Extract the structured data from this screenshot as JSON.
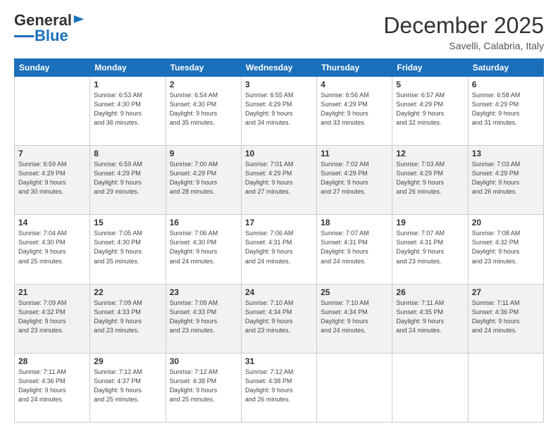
{
  "logo": {
    "general": "General",
    "blue": "Blue"
  },
  "header": {
    "month": "December 2025",
    "location": "Savelli, Calabria, Italy"
  },
  "days_of_week": [
    "Sunday",
    "Monday",
    "Tuesday",
    "Wednesday",
    "Thursday",
    "Friday",
    "Saturday"
  ],
  "weeks": [
    [
      {
        "day": "",
        "info": ""
      },
      {
        "day": "1",
        "info": "Sunrise: 6:53 AM\nSunset: 4:30 PM\nDaylight: 9 hours\nand 36 minutes."
      },
      {
        "day": "2",
        "info": "Sunrise: 6:54 AM\nSunset: 4:30 PM\nDaylight: 9 hours\nand 35 minutes."
      },
      {
        "day": "3",
        "info": "Sunrise: 6:55 AM\nSunset: 4:29 PM\nDaylight: 9 hours\nand 34 minutes."
      },
      {
        "day": "4",
        "info": "Sunrise: 6:56 AM\nSunset: 4:29 PM\nDaylight: 9 hours\nand 33 minutes."
      },
      {
        "day": "5",
        "info": "Sunrise: 6:57 AM\nSunset: 4:29 PM\nDaylight: 9 hours\nand 32 minutes."
      },
      {
        "day": "6",
        "info": "Sunrise: 6:58 AM\nSunset: 4:29 PM\nDaylight: 9 hours\nand 31 minutes."
      }
    ],
    [
      {
        "day": "7",
        "info": "Sunrise: 6:59 AM\nSunset: 4:29 PM\nDaylight: 9 hours\nand 30 minutes."
      },
      {
        "day": "8",
        "info": "Sunrise: 6:59 AM\nSunset: 4:29 PM\nDaylight: 9 hours\nand 29 minutes."
      },
      {
        "day": "9",
        "info": "Sunrise: 7:00 AM\nSunset: 4:29 PM\nDaylight: 9 hours\nand 28 minutes."
      },
      {
        "day": "10",
        "info": "Sunrise: 7:01 AM\nSunset: 4:29 PM\nDaylight: 9 hours\nand 27 minutes."
      },
      {
        "day": "11",
        "info": "Sunrise: 7:02 AM\nSunset: 4:29 PM\nDaylight: 9 hours\nand 27 minutes."
      },
      {
        "day": "12",
        "info": "Sunrise: 7:03 AM\nSunset: 4:29 PM\nDaylight: 9 hours\nand 26 minutes."
      },
      {
        "day": "13",
        "info": "Sunrise: 7:03 AM\nSunset: 4:29 PM\nDaylight: 9 hours\nand 26 minutes."
      }
    ],
    [
      {
        "day": "14",
        "info": "Sunrise: 7:04 AM\nSunset: 4:30 PM\nDaylight: 9 hours\nand 25 minutes."
      },
      {
        "day": "15",
        "info": "Sunrise: 7:05 AM\nSunset: 4:30 PM\nDaylight: 9 hours\nand 25 minutes."
      },
      {
        "day": "16",
        "info": "Sunrise: 7:06 AM\nSunset: 4:30 PM\nDaylight: 9 hours\nand 24 minutes."
      },
      {
        "day": "17",
        "info": "Sunrise: 7:06 AM\nSunset: 4:31 PM\nDaylight: 9 hours\nand 24 minutes."
      },
      {
        "day": "18",
        "info": "Sunrise: 7:07 AM\nSunset: 4:31 PM\nDaylight: 9 hours\nand 24 minutes."
      },
      {
        "day": "19",
        "info": "Sunrise: 7:07 AM\nSunset: 4:31 PM\nDaylight: 9 hours\nand 23 minutes."
      },
      {
        "day": "20",
        "info": "Sunrise: 7:08 AM\nSunset: 4:32 PM\nDaylight: 9 hours\nand 23 minutes."
      }
    ],
    [
      {
        "day": "21",
        "info": "Sunrise: 7:09 AM\nSunset: 4:32 PM\nDaylight: 9 hours\nand 23 minutes."
      },
      {
        "day": "22",
        "info": "Sunrise: 7:09 AM\nSunset: 4:33 PM\nDaylight: 9 hours\nand 23 minutes."
      },
      {
        "day": "23",
        "info": "Sunrise: 7:09 AM\nSunset: 4:33 PM\nDaylight: 9 hours\nand 23 minutes."
      },
      {
        "day": "24",
        "info": "Sunrise: 7:10 AM\nSunset: 4:34 PM\nDaylight: 9 hours\nand 23 minutes."
      },
      {
        "day": "25",
        "info": "Sunrise: 7:10 AM\nSunset: 4:34 PM\nDaylight: 9 hours\nand 24 minutes."
      },
      {
        "day": "26",
        "info": "Sunrise: 7:11 AM\nSunset: 4:35 PM\nDaylight: 9 hours\nand 24 minutes."
      },
      {
        "day": "27",
        "info": "Sunrise: 7:11 AM\nSunset: 4:36 PM\nDaylight: 9 hours\nand 24 minutes."
      }
    ],
    [
      {
        "day": "28",
        "info": "Sunrise: 7:11 AM\nSunset: 4:36 PM\nDaylight: 9 hours\nand 24 minutes."
      },
      {
        "day": "29",
        "info": "Sunrise: 7:12 AM\nSunset: 4:37 PM\nDaylight: 9 hours\nand 25 minutes."
      },
      {
        "day": "30",
        "info": "Sunrise: 7:12 AM\nSunset: 4:38 PM\nDaylight: 9 hours\nand 25 minutes."
      },
      {
        "day": "31",
        "info": "Sunrise: 7:12 AM\nSunset: 4:38 PM\nDaylight: 9 hours\nand 26 minutes."
      },
      {
        "day": "",
        "info": ""
      },
      {
        "day": "",
        "info": ""
      },
      {
        "day": "",
        "info": ""
      }
    ]
  ]
}
